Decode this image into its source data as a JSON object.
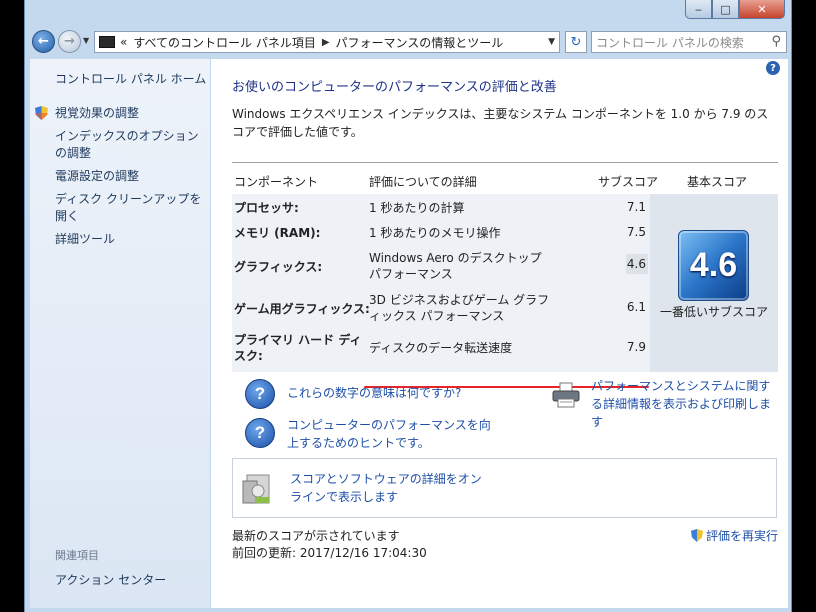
{
  "window": {
    "controls": {
      "minimize": "‒",
      "maximize": "□",
      "close": "✕"
    }
  },
  "toolbar": {
    "breadcrumb_prefix": "«",
    "crumb1": "すべてのコントロール パネル項目",
    "crumb2": "パフォーマンスの情報とツール",
    "search_placeholder": "コントロール パネルの検索"
  },
  "sidebar": {
    "items": [
      {
        "label": "コントロール パネル ホーム"
      },
      {
        "label": "視覚効果の調整",
        "icon": "shield-icon"
      },
      {
        "label": "インデックスのオプションの調整"
      },
      {
        "label": "電源設定の調整"
      },
      {
        "label": "ディスク クリーンアップを開く"
      },
      {
        "label": "詳細ツール"
      }
    ],
    "related_title": "関連項目",
    "related_link": "アクション センター"
  },
  "main": {
    "heading": "お使いのコンピューターのパフォーマンスの評価と改善",
    "description": "Windows エクスペリエンス インデックスは、主要なシステム コンポーネントを 1.0 から 7.9 のスコアで評価した値です。",
    "columns": {
      "component": "コンポーネント",
      "detail": "評価についての詳細",
      "subscore": "サブスコア",
      "base": "基本スコア"
    },
    "rows": [
      {
        "label": "プロセッサ:",
        "detail": "1 秒あたりの計算",
        "score": "7.1"
      },
      {
        "label": "メモリ (RAM):",
        "detail": "1 秒あたりのメモリ操作",
        "score": "7.5"
      },
      {
        "label": "グラフィックス:",
        "detail": "Windows Aero のデスクトップ パフォーマンス",
        "score": "4.6"
      },
      {
        "label": "ゲーム用グラフィックス:",
        "detail": "3D ビジネスおよびゲーム グラフィックス パフォーマンス",
        "score": "6.1"
      },
      {
        "label": "プライマリ ハード ディスク:",
        "detail": "ディスクのデータ転送速度",
        "score": "7.9"
      }
    ],
    "base_score": "4.6",
    "base_caption": "一番低いサブスコア",
    "links": {
      "meaning": "これらの数字の意味は何ですか?",
      "tips": "コンピューターのパフォーマンスを向上するためのヒントです。",
      "print": "パフォーマンスとシステムに関する詳細情報を表示および印刷します",
      "online": "スコアとソフトウェアの詳細をオンラインで表示します"
    },
    "footer": {
      "status": "最新のスコアが示されています",
      "last_update": "前回の更新: 2017/12/16 17:04:30",
      "rerun": "評価を再実行"
    }
  }
}
